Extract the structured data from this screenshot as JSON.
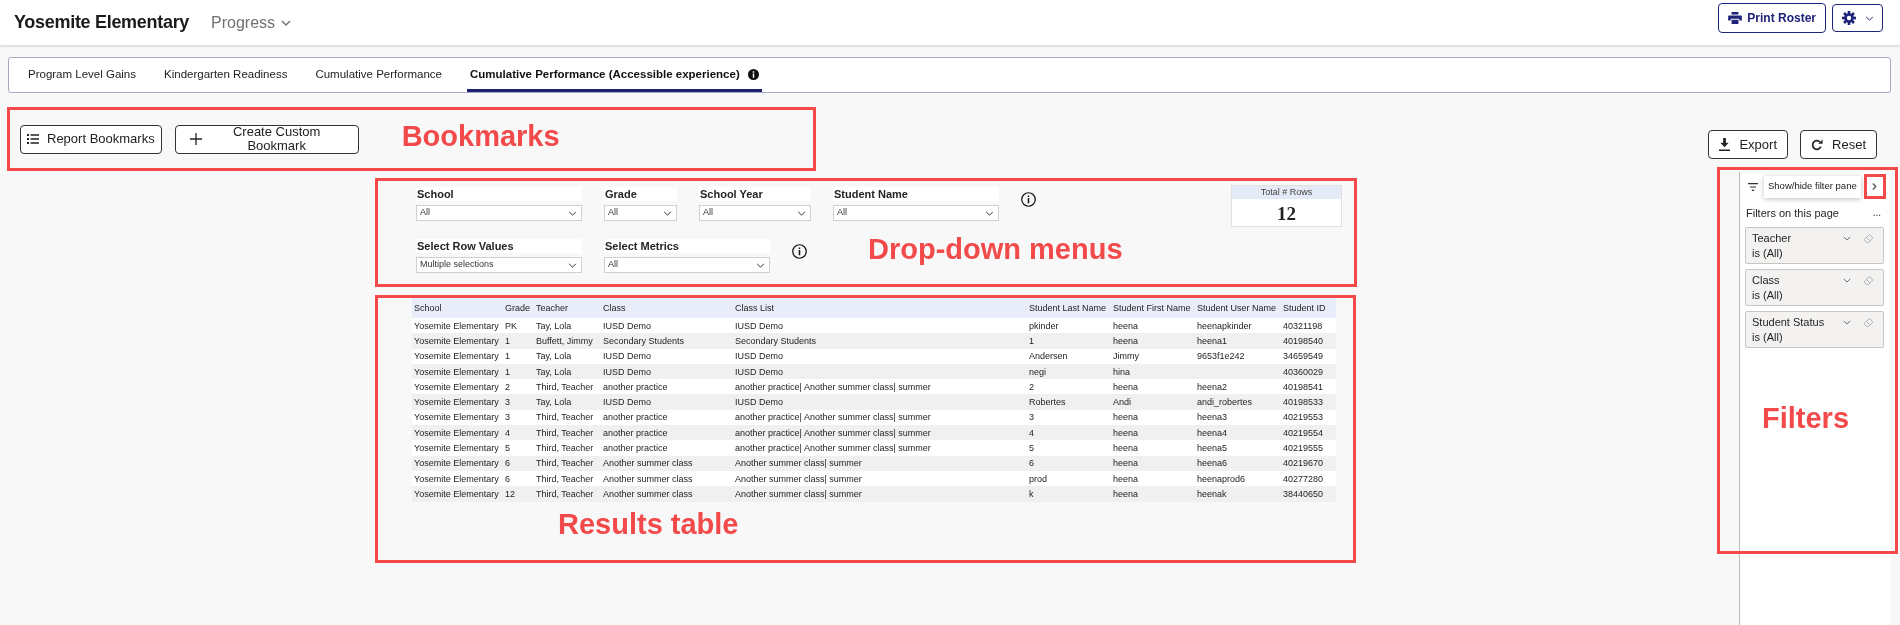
{
  "header": {
    "title": "Yosemite Elementary",
    "menu": "Progress",
    "actions": [
      {
        "kind": "print",
        "label": "Print Roster"
      },
      {
        "kind": "settings"
      }
    ]
  },
  "tabs": [
    {
      "label": "Program Level Gains",
      "selected": false,
      "info": false
    },
    {
      "label": "Kindergarten Readiness",
      "selected": false,
      "info": false
    },
    {
      "label": "Cumulative Performance",
      "selected": false,
      "info": false
    },
    {
      "label": "Cumulative Performance (Accessible experience)",
      "selected": true,
      "info": true
    }
  ],
  "bookmarks": {
    "buttons": [
      {
        "kind": "list",
        "label": "Report Bookmarks"
      },
      {
        "kind": "add",
        "label": "Create Custom Bookmark"
      }
    ]
  },
  "report_actions": [
    {
      "kind": "export",
      "label": "Export"
    },
    {
      "kind": "reset",
      "label": "Reset"
    }
  ],
  "slicer_rows": [
    {
      "info": true,
      "slicers": [
        {
          "label": "School",
          "value": "All"
        },
        {
          "label": "Grade",
          "value": "All"
        },
        {
          "label": "School Year",
          "value": "All"
        },
        {
          "label": "Student Name",
          "value": "All"
        }
      ]
    },
    {
      "info": true,
      "slicers": [
        {
          "label": "Select Row Values",
          "value": "Multiple selections"
        },
        {
          "label": "Select Metrics",
          "value": "All"
        }
      ]
    }
  ],
  "total_rows_card": {
    "label": "Total # Rows",
    "value": "12"
  },
  "table": {
    "columns": [
      "School",
      "Grade",
      "Teacher",
      "Class",
      "Class List",
      "Student Last Name",
      "Student First Name",
      "Student User Name",
      "Student ID"
    ],
    "rows": [
      [
        "Yosemite Elementary",
        "PK",
        "Tay, Lola",
        "IUSD Demo",
        "IUSD Demo",
        "pkinder",
        "heena",
        "heenapkinder",
        "40321198"
      ],
      [
        "Yosemite Elementary",
        "1",
        "Buffett, Jimmy",
        "Secondary Students",
        "Secondary Students",
        "1",
        "heena",
        "heena1",
        "40198540"
      ],
      [
        "Yosemite Elementary",
        "1",
        "Tay, Lola",
        "IUSD Demo",
        "IUSD Demo",
        "Andersen",
        "Jimmy",
        "9653f1e242",
        "34659549"
      ],
      [
        "Yosemite Elementary",
        "1",
        "Tay, Lola",
        "IUSD Demo",
        "IUSD Demo",
        "negi",
        "hina",
        null,
        "40360029"
      ],
      [
        "Yosemite Elementary",
        "2",
        "Third, Teacher",
        "another practice",
        "another practice| Another summer class| summer",
        "2",
        "heena",
        "heena2",
        "40198541"
      ],
      [
        "Yosemite Elementary",
        "3",
        "Tay, Lola",
        "IUSD Demo",
        "IUSD Demo",
        "Robertes",
        "Andi",
        "andi_robertes",
        "40198533"
      ],
      [
        "Yosemite Elementary",
        "3",
        "Third, Teacher",
        "another practice",
        "another practice| Another summer class| summer",
        "3",
        "heena",
        "heena3",
        "40219553"
      ],
      [
        "Yosemite Elementary",
        "4",
        "Third, Teacher",
        "another practice",
        "another practice| Another summer class| summer",
        "4",
        "heena",
        "heena4",
        "40219554"
      ],
      [
        "Yosemite Elementary",
        "5",
        "Third, Teacher",
        "another practice",
        "another practice| Another summer class| summer",
        "5",
        "heena",
        "heena5",
        "40219555"
      ],
      [
        "Yosemite Elementary",
        "6",
        "Third, Teacher",
        "Another summer class",
        "Another summer class| summer",
        "6",
        "heena",
        "heena6",
        "40219670"
      ],
      [
        "Yosemite Elementary",
        "6",
        "Third, Teacher",
        "Another summer class",
        "Another summer class| summer",
        "prod",
        "heena",
        "heenaprod6",
        "40277280"
      ],
      [
        "Yosemite Elementary",
        "12",
        "Third, Teacher",
        "Another summer class",
        "Another summer class| summer",
        "k",
        "heena",
        "heenak",
        "38440650"
      ]
    ]
  },
  "filter_pane": {
    "tooltip": "Show/hide filter pane",
    "toggle_highlighted": true,
    "heading": "Filters on this page",
    "more": "...",
    "filters": [
      {
        "field": "Teacher",
        "condition": "is (All)"
      },
      {
        "field": "Class",
        "condition": "is (All)"
      },
      {
        "field": "Student Status",
        "condition": "is (All)"
      }
    ]
  },
  "annotations": [
    {
      "label": "Bookmarks"
    },
    {
      "label": "Drop-down menus"
    },
    {
      "label": "Results table"
    },
    {
      "label": "Filters"
    }
  ]
}
